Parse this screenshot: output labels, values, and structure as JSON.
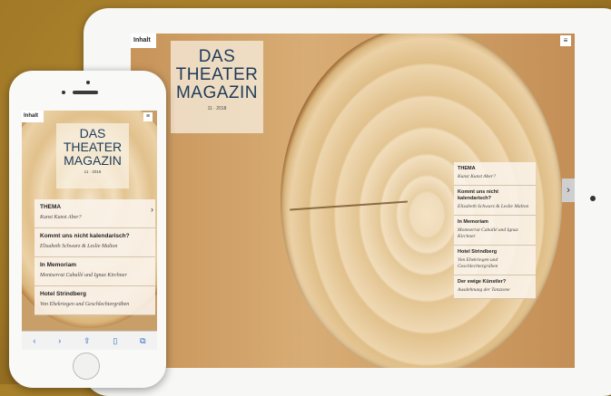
{
  "menu": {
    "inhalt": "Inhalt",
    "menu_glyph": "≡"
  },
  "magazine": {
    "title_line1": "DAS",
    "title_line2": "THEATER",
    "title_line3": "MAGAZIN",
    "issue": "11 · 2018"
  },
  "toc": [
    {
      "heading": "THEMA",
      "sub": "Kunst Kunst Aber?"
    },
    {
      "heading": "Kommt uns nicht kalendarisch?",
      "sub": "Elisabeth Schwarz & Leslie Malton"
    },
    {
      "heading": "In Memoriam",
      "sub": "Montserrat Caballé und Ignaz Kirchner"
    },
    {
      "heading": "Hotel Strindberg",
      "sub": "Von Ehekriegen und Geschlechtergräben"
    },
    {
      "heading": "Der ewige Künstler?",
      "sub": "Ausdehnung der Tanzzone"
    }
  ],
  "ipad": {
    "next_arrow": "›"
  },
  "iphone": {
    "chevron": "›",
    "toolbar": [
      "‹",
      "›",
      "⇪",
      "▯",
      "⧉"
    ]
  },
  "colors": {
    "background": "#a8802a",
    "title_blue": "#1e3b5a",
    "wood": "#f0dcba"
  }
}
